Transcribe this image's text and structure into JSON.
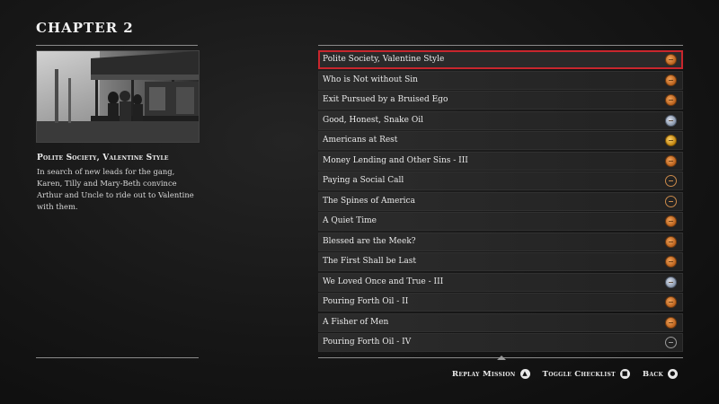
{
  "header": {
    "chapter_title": "CHAPTER 2"
  },
  "detail": {
    "mission_name": "Polite Society, Valentine Style",
    "description": "In search of new leads for the gang, Karen, Tilly and Mary-Beth convince Arthur and Uncle to ride out to Valentine with them."
  },
  "missions": [
    {
      "label": "Polite Society, Valentine Style",
      "medal": "bronze"
    },
    {
      "label": "Who is Not without Sin",
      "medal": "bronze"
    },
    {
      "label": "Exit Pursued by a Bruised Ego",
      "medal": "bronze"
    },
    {
      "label": "Good, Honest, Snake Oil",
      "medal": "silver"
    },
    {
      "label": "Americans at Rest",
      "medal": "gold"
    },
    {
      "label": "Money Lending and Other Sins - III",
      "medal": "bronze"
    },
    {
      "label": "Paying a Social Call",
      "medal": "none"
    },
    {
      "label": "The Spines of America",
      "medal": "none"
    },
    {
      "label": "A Quiet Time",
      "medal": "bronze"
    },
    {
      "label": "Blessed are the Meek?",
      "medal": "bronze"
    },
    {
      "label": "The First Shall be Last",
      "medal": "bronze"
    },
    {
      "label": "We Loved Once and True - III",
      "medal": "silver"
    },
    {
      "label": "Pouring Forth Oil - II",
      "medal": "bronze"
    },
    {
      "label": "A Fisher of Men",
      "medal": "bronze"
    },
    {
      "label": "Pouring Forth Oil - IV",
      "medal": "none-grey"
    }
  ],
  "selected_index": 0,
  "footer": {
    "replay_label": "Replay Mission",
    "replay_icon": "triangle-button-icon",
    "checklist_label": "Toggle Checklist",
    "checklist_icon": "square-button-icon",
    "back_label": "Back",
    "back_icon": "circle-button-icon"
  },
  "colors": {
    "selection": "#c8262d",
    "background": "#161616"
  }
}
